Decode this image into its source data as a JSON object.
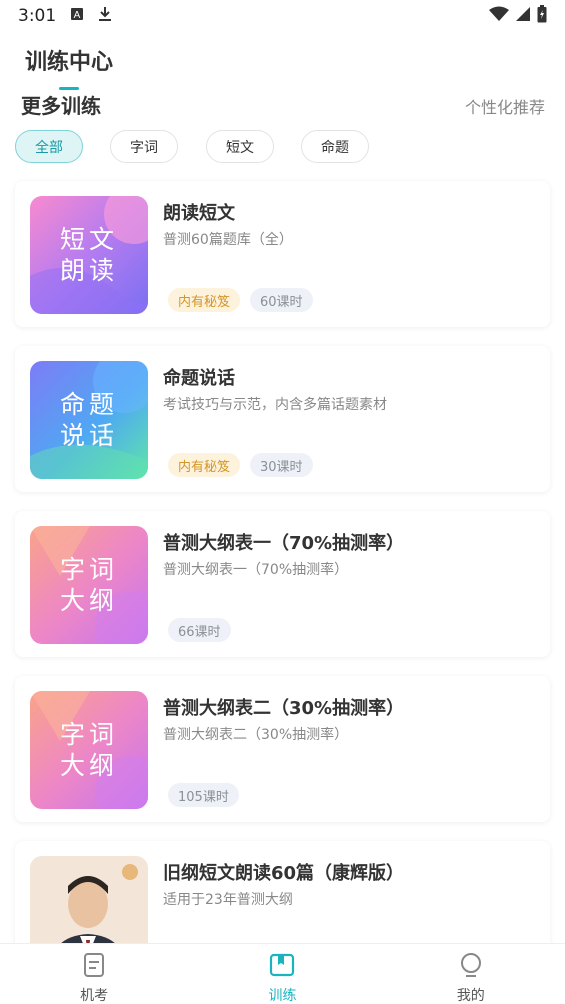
{
  "status_bar": {
    "time": "3:01"
  },
  "page_title": "训练中心",
  "section": {
    "title": "更多训练",
    "recommend": "个性化推荐"
  },
  "filters": [
    "全部",
    "字词",
    "短文",
    "命题"
  ],
  "cards": [
    {
      "thumb_lines": [
        "短文",
        "朗读"
      ],
      "title": "朗读短文",
      "subtitle": "普测60篇题库（全）",
      "tag_gold": "内有秘笈",
      "tag_gray": "60课时"
    },
    {
      "thumb_lines": [
        "命题",
        "说话"
      ],
      "title": "命题说话",
      "subtitle": "考试技巧与示范，内含多篇话题素材",
      "tag_gold": "内有秘笈",
      "tag_gray": "30课时"
    },
    {
      "thumb_lines": [
        "字词",
        "大纲"
      ],
      "title": "普测大纲表一（70%抽测率）",
      "subtitle": "普测大纲表一（70%抽测率）",
      "tag_gray": "66课时"
    },
    {
      "thumb_lines": [
        "字词",
        "大纲"
      ],
      "title": "普测大纲表二（30%抽测率）",
      "subtitle": "普测大纲表二（30%抽测率）",
      "tag_gray": "105课时"
    },
    {
      "title": "旧纲短文朗读60篇（康辉版）",
      "subtitle": "适用于23年普测大纲"
    }
  ],
  "tabbar": [
    {
      "label": "机考",
      "icon": "exam-icon"
    },
    {
      "label": "训练",
      "icon": "book-icon",
      "active": true
    },
    {
      "label": "我的",
      "icon": "profile-icon"
    }
  ],
  "colors": {
    "accent": "#19b4c0",
    "tag_gold": "#d49628"
  }
}
